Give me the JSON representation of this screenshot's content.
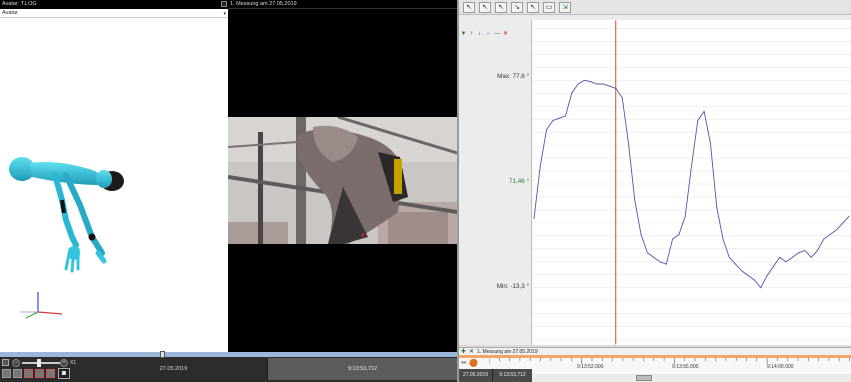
{
  "avatar_panel": {
    "title": "Avatar: T.LOG",
    "select_value": "Avatar"
  },
  "video_panel": {
    "title": "1. Messung am 27.05.2019"
  },
  "graph": {
    "max_label": "Max: 77,6 °",
    "mid_label": "71,46 °",
    "min_label": "Min: -13,3 °",
    "colors": {
      "curve": "#4f58a6",
      "cursor": "#e0462e",
      "mid_label": "#1e7d2a"
    }
  },
  "chart_data": {
    "type": "line",
    "title": "",
    "xlabel": "",
    "ylabel": "",
    "ylim": [
      -13.3,
      77.6
    ],
    "x_ticks": [
      "9:13:52.000",
      "9:13:56.000",
      "9:14:00.000"
    ],
    "cursor_time": "9:13:53,712",
    "series": [
      {
        "x": [
          0,
          2,
          4,
          6,
          8,
          10,
          12,
          14,
          16,
          18,
          20,
          22,
          24,
          26,
          28,
          30,
          32,
          34,
          36,
          38,
          40,
          42,
          44,
          46,
          48,
          50,
          52,
          54,
          56,
          58,
          60,
          62,
          64,
          66,
          68,
          70,
          72,
          74,
          76,
          78,
          80,
          82,
          84,
          86,
          88,
          90,
          92,
          94,
          96,
          98,
          100
        ],
        "values": [
          17,
          40,
          56,
          60,
          61,
          62,
          72,
          76,
          77.6,
          77,
          76,
          76,
          75,
          74,
          70,
          50,
          25,
          10,
          2,
          0,
          -2,
          -3,
          8,
          10,
          18,
          40,
          60,
          64,
          50,
          22,
          8,
          0,
          -3,
          -6,
          -8,
          -10,
          -13.3,
          -8,
          -4,
          0,
          -2,
          0,
          2,
          3,
          0,
          3,
          8,
          10,
          12,
          15,
          18
        ]
      }
    ]
  },
  "measure_bar": {
    "title": "1. Messung am 27.05.2019"
  },
  "bottom_left": {
    "zoom": "X1",
    "date": "27.05.2019",
    "time": "9:13:53,712"
  },
  "bottom_graph": {
    "date": "27.05.2019",
    "time": "9:13:53,712"
  }
}
